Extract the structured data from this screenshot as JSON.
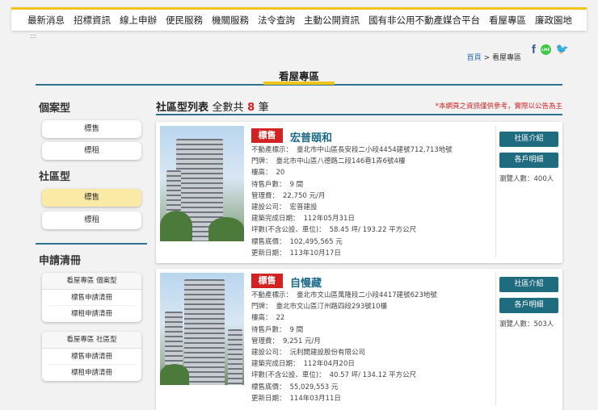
{
  "nav": [
    "最新消息",
    "招標資訊",
    "線上申辦",
    "便民服務",
    "機關服務",
    "法令查詢",
    "主動公開資訊",
    "國有非公用不動產媒合平台",
    "看屋專區",
    "廉政園地"
  ],
  "dots": ":::",
  "breadcrumb": {
    "home": "首頁",
    "sep": ">",
    "current": "看屋專區"
  },
  "social": {
    "fb": "f",
    "line": "LINE",
    "tw": "🐦"
  },
  "page_title": "看屋專區",
  "sidebar": {
    "h1": "個案型",
    "case_sale": "標售",
    "case_rent": "標租",
    "h2": "社區型",
    "comm_sale": "標售",
    "comm_rent": "標租",
    "h3": "申請清冊",
    "g1_head": "看屋專區 個案型",
    "g1_a": "標售申請清冊",
    "g1_b": "標租申請清冊",
    "g2_head": "看屋專區 社區型",
    "g2_a": "標售申請清冊",
    "g2_b": "標租申請清冊"
  },
  "list": {
    "title": "社區型列表",
    "count_pre": "全數共",
    "count": "8",
    "count_post": "筆",
    "notice": "*本網頁之資訊僅供參考，實際以公告為主"
  },
  "buttons": {
    "intro": "社區介紹",
    "units": "各戶明細"
  },
  "labels": {
    "land": "不動產標示：",
    "door": "門牌：",
    "floors": "樓高：",
    "pending": "待售戶數：",
    "fee": "管理費：",
    "builder": "建設公司：",
    "done": "建築完成日期：",
    "area": "坪數(不含公設、車位)：",
    "price": "標售底價：",
    "updated": "更新日期：",
    "views": "瀏覽人數："
  },
  "cards": [
    {
      "tag": "標售",
      "name": "宏普頤和",
      "land": "臺北市中山區長安段二小段4454建號712,713地號",
      "door": "臺北市中山區八德路二段146巷1弄6號4樓",
      "floors": "20",
      "pending": "9 間",
      "fee": "22,750 元/月",
      "builder": "宏普建設",
      "done": "112年05月31日",
      "area": "58.45 坪/ 193.22 平方公尺",
      "price": "102,495,565 元",
      "updated": "113年10月17日",
      "views": "400人"
    },
    {
      "tag": "標售",
      "name": "自慢藏",
      "land": "臺北市文山區萬隆段二小段4417建號623地號",
      "door": "臺北市文山區汀州路四段293號10樓",
      "floors": "22",
      "pending": "9 間",
      "fee": "9,251 元/月",
      "builder": "沅利開建設股份有限公司",
      "done": "112年04月20日",
      "area": "40.57 坪/ 134.12 平方公尺",
      "price": "55,029,553 元",
      "updated": "114年03月11日",
      "views": "503人"
    }
  ]
}
